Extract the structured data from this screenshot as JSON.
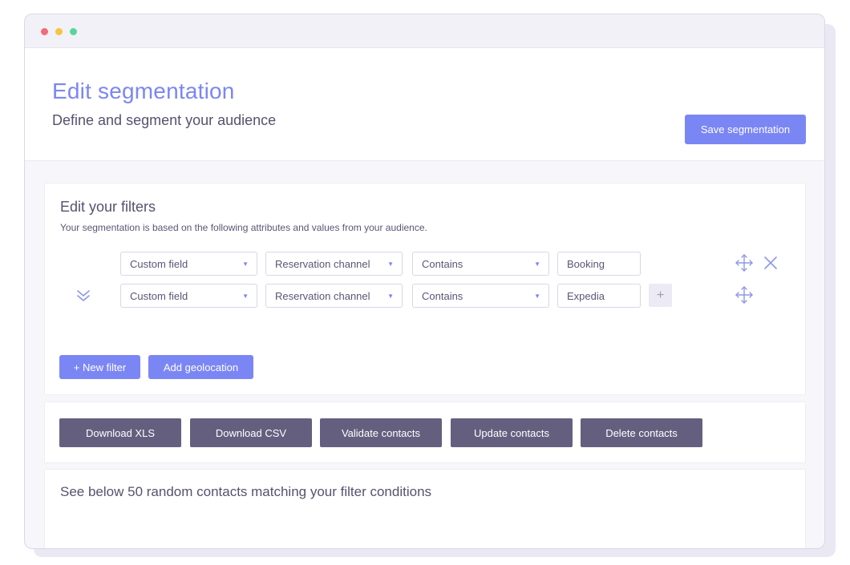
{
  "window": {
    "controls": [
      "close",
      "minimize",
      "maximize"
    ]
  },
  "header": {
    "title": "Edit segmentation",
    "subtitle": "Define and segment your audience",
    "save_label": "Save segmentation"
  },
  "filters": {
    "title": "Edit your filters",
    "description": "Your segmentation is based on the following attributes and values from your audience.",
    "rows": [
      {
        "type": "Custom field",
        "attribute": "Reservation channel",
        "operator": "Contains",
        "value": "Booking"
      },
      {
        "type": "Custom field",
        "attribute": "Reservation channel",
        "operator": "Contains",
        "value": "Expedia"
      }
    ],
    "add_value_label": "+",
    "new_filter_label": "+ New filter",
    "add_geolocation_label": "Add geolocation",
    "icons": {
      "move": "move-icon",
      "delete": "close-icon",
      "collapse": "chevrons-down-icon"
    }
  },
  "actions": {
    "buttons": [
      "Download XLS",
      "Download CSV",
      "Validate contacts",
      "Update contacts",
      "Delete contacts"
    ]
  },
  "contacts": {
    "text": "See below 50 random contacts matching your filter conditions"
  },
  "colors": {
    "accent": "#7b86f5",
    "dark_button": "#655f7f",
    "text": "#55526e",
    "background": "#f7f6fb"
  }
}
